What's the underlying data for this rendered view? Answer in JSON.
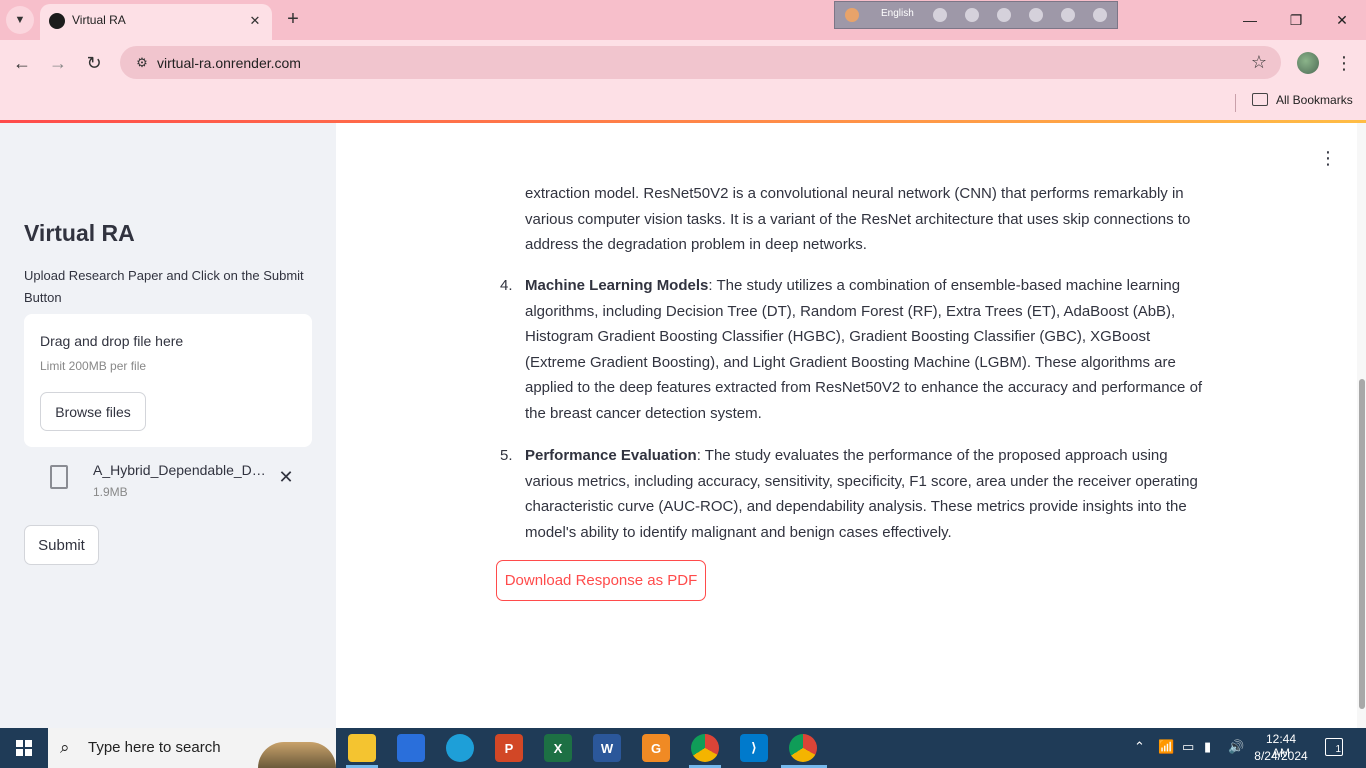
{
  "browser": {
    "tab_title": "Virtual RA",
    "url": "virtual-ra.onrender.com",
    "bookmarks_label": "All Bookmarks",
    "language": "English",
    "accent_color": "#ff4b4b"
  },
  "sidebar": {
    "title": "Virtual RA",
    "caption": "Upload Research Paper and Click on the Submit Button",
    "uploader": {
      "drag_text": "Drag and drop file here",
      "limit_text": "Limit 200MB per file",
      "browse_label": "Browse files"
    },
    "file": {
      "name": "A_Hybrid_Dependable_Deep_Feature_Extraction.pdf",
      "size": "1.9MB"
    },
    "submit_label": "Submit"
  },
  "main": {
    "intro_text": "extraction model. ResNet50V2 is a convolutional neural network (CNN) that performs remarkably in various computer vision tasks. It is a variant of the ResNet architecture that uses skip connections to address the degradation problem in deep networks.",
    "items": [
      {
        "number": "4.",
        "heading": "Machine Learning Models",
        "text": ": The study utilizes a combination of ensemble-based machine learning algorithms, including Decision Tree (DT), Random Forest (RF), Extra Trees (ET), AdaBoost (AbB), Histogram Gradient Boosting Classifier (HGBC), Gradient Boosting Classifier (GBC), XGBoost (Extreme Gradient Boosting), and Light Gradient Boosting Machine (LGBM). These algorithms are applied to the deep features extracted from ResNet50V2 to enhance the accuracy and performance of the breast cancer detection system."
      },
      {
        "number": "5.",
        "heading": "Performance Evaluation",
        "text": ": The study evaluates the performance of the proposed approach using various metrics, including accuracy, sensitivity, specificity, F1 score, area under the receiver operating characteristic curve (AUC-ROC), and dependability analysis. These metrics provide insights into the model's ability to identify malignant and benign cases effectively."
      }
    ],
    "download_label": "Download Response as PDF"
  },
  "taskbar": {
    "search_placeholder": "Type here to search",
    "time": "12:44 AM",
    "date": "8/24/2024",
    "notification_count": "1"
  }
}
